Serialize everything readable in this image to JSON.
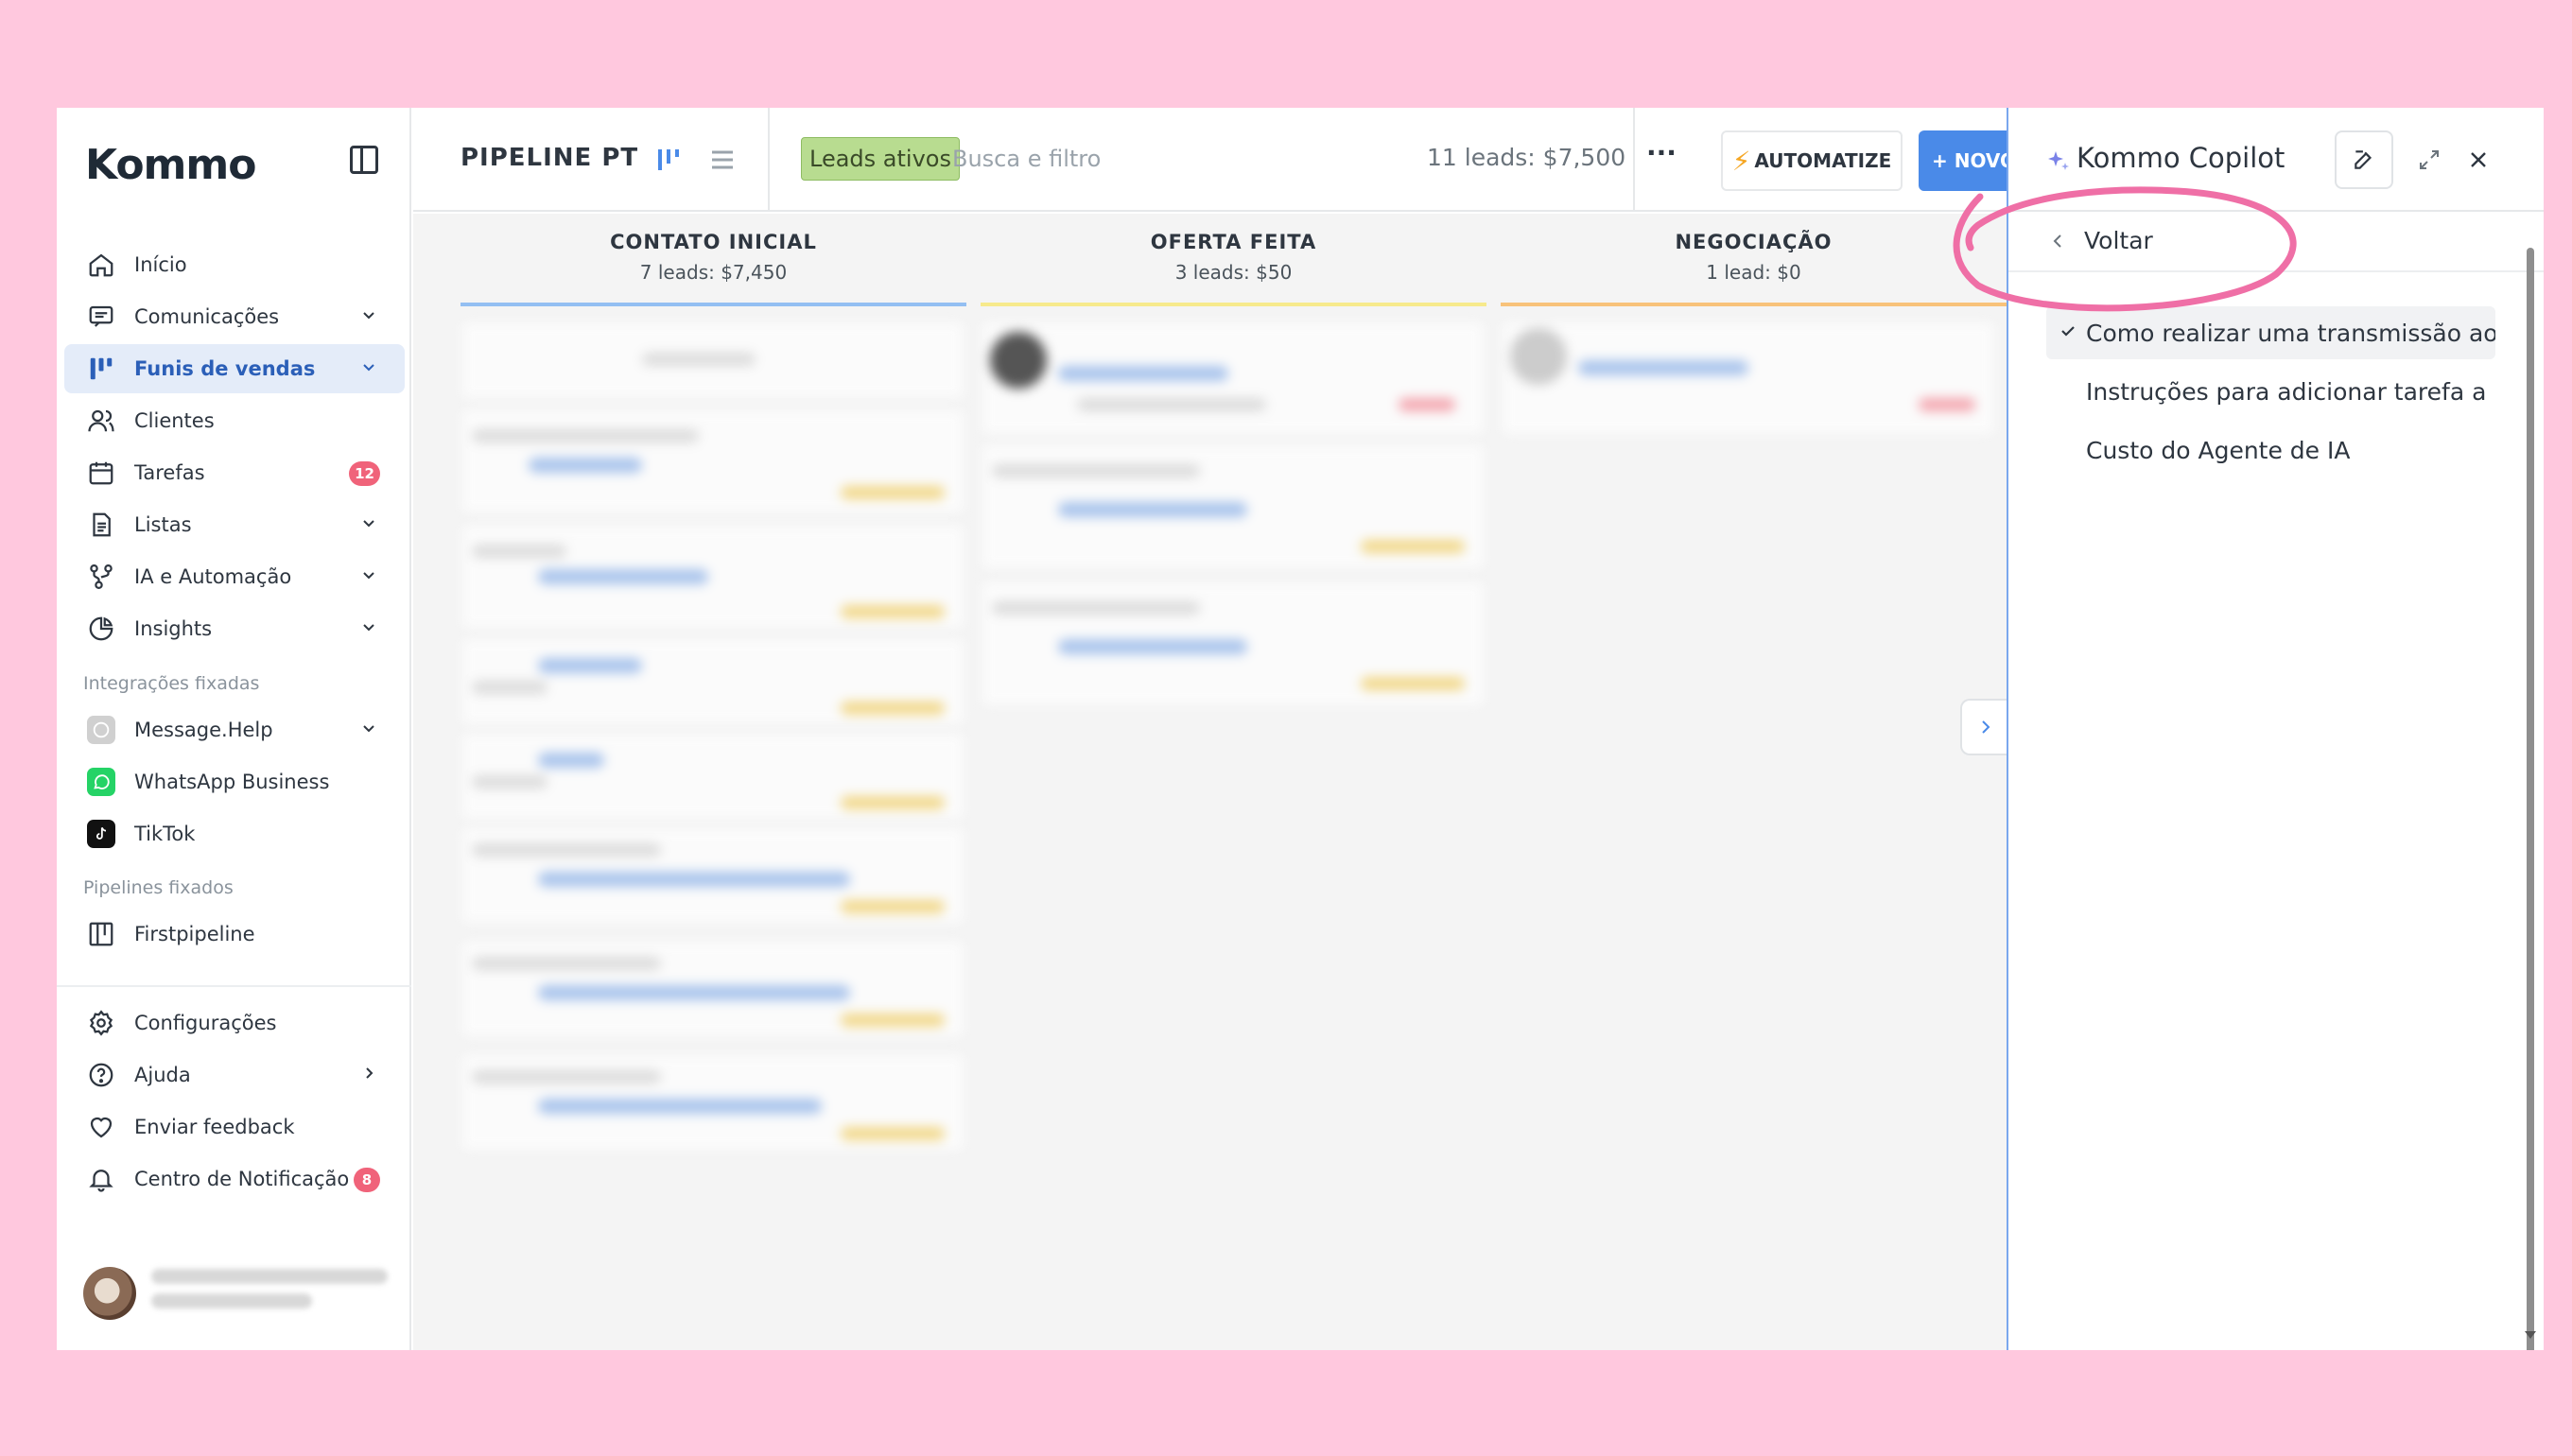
{
  "sidebar": {
    "logo": "Kommo",
    "nav": [
      {
        "label": "Início",
        "icon": "home-icon"
      },
      {
        "label": "Comunicações",
        "icon": "chat-icon",
        "has_chevron": true
      },
      {
        "label": "Funis de vendas",
        "icon": "kanban-icon",
        "has_chevron": true,
        "active": true
      },
      {
        "label": "Clientes",
        "icon": "users-icon"
      },
      {
        "label": "Tarefas",
        "icon": "calendar-icon",
        "badge": "12"
      },
      {
        "label": "Listas",
        "icon": "document-icon",
        "has_chevron": true
      },
      {
        "label": "IA e Automação",
        "icon": "flow-icon",
        "has_chevron": true
      },
      {
        "label": "Insights",
        "icon": "pie-chart-icon",
        "has_chevron": true
      }
    ],
    "integrations_label": "Integrações fixadas",
    "integrations": [
      {
        "label": "Message.Help",
        "icon": "message-help-icon",
        "color": "#c9c9c9"
      },
      {
        "label": "WhatsApp Business",
        "icon": "whatsapp-icon",
        "color": "#25d366"
      },
      {
        "label": "TikTok",
        "icon": "tiktok-icon",
        "color": "#111111"
      }
    ],
    "pipelines_label": "Pipelines fixados",
    "pipelines": [
      {
        "label": "Firstpipeline",
        "icon": "pipeline-icon"
      }
    ],
    "bottom": [
      {
        "label": "Configurações",
        "icon": "gear-icon"
      },
      {
        "label": "Ajuda",
        "icon": "help-icon",
        "has_arrow": true
      },
      {
        "label": "Enviar feedback",
        "icon": "heart-icon"
      },
      {
        "label": "Centro de Notificação",
        "icon": "bell-icon",
        "badge": "8"
      }
    ]
  },
  "header": {
    "pipeline_title": "PIPELINE PT",
    "filter_tag": "Leads ativos",
    "search_placeholder": "Busca e filtro",
    "lead_summary": "11 leads: $7,500",
    "more": "···",
    "automate_label": "AUTOMATIZE",
    "new_lead_label": "+ NOVO LEAD"
  },
  "board": {
    "columns": [
      {
        "title": "CONTATO INICIAL",
        "summary": "7 leads: $7,450",
        "color": "#93bff2"
      },
      {
        "title": "OFERTA FEITA",
        "summary": "3 leads: $50",
        "color": "#f7ea8c"
      },
      {
        "title": "NEGOCIAÇÃO",
        "summary": "1 lead: $0",
        "color": "#f8c27a"
      }
    ]
  },
  "copilot": {
    "title": "Kommo Copilot",
    "back_label": "Voltar",
    "history": [
      {
        "label": "Como realizar uma transmissão ao ...",
        "selected": true
      },
      {
        "label": "Instruções para adicionar tarefa a u...",
        "selected": false
      },
      {
        "label": "Custo do Agente de IA",
        "selected": false
      }
    ],
    "accent_color": "#7aa7ee",
    "annotation_color": "#ef6fa6"
  }
}
